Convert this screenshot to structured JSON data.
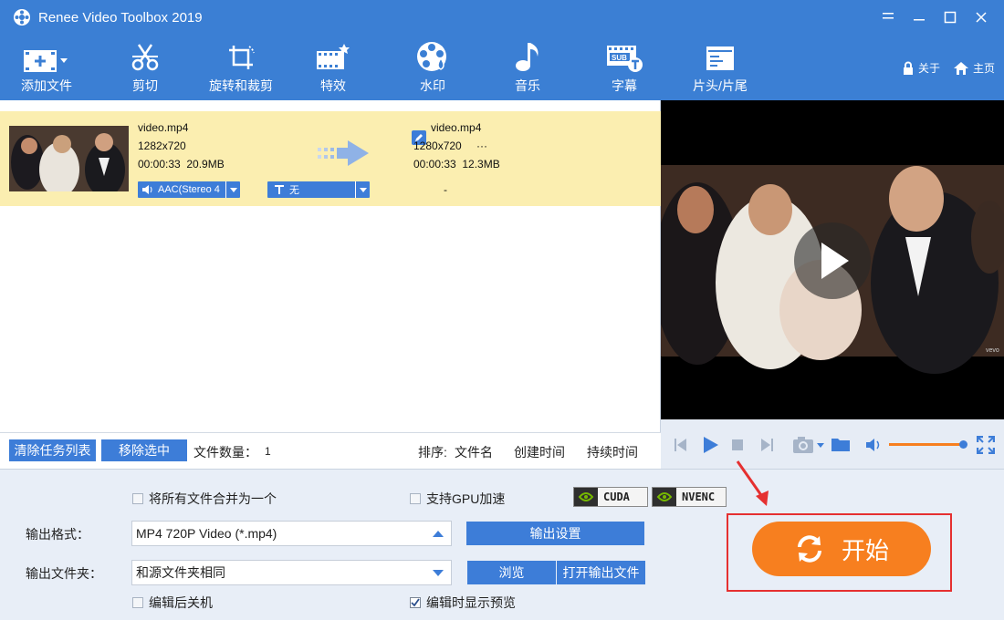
{
  "window": {
    "title": "Renee Video Toolbox 2019"
  },
  "toolbar": {
    "items": [
      {
        "label": "添加文件",
        "icon": "add-file-icon"
      },
      {
        "label": "剪切",
        "icon": "scissors-icon"
      },
      {
        "label": "旋转和裁剪",
        "icon": "rotate-crop-icon"
      },
      {
        "label": "特效",
        "icon": "effects-icon"
      },
      {
        "label": "水印",
        "icon": "watermark-icon"
      },
      {
        "label": "音乐",
        "icon": "music-note-icon"
      },
      {
        "label": "字幕",
        "icon": "subtitle-icon"
      },
      {
        "label": "片头/片尾",
        "icon": "intro-outro-icon"
      }
    ],
    "about_label": "关于",
    "home_label": "主页"
  },
  "file": {
    "source": {
      "name": "video.mp4",
      "resolution": "1282x720",
      "duration_size": "00:00:33  20.9MB"
    },
    "output": {
      "name": "video.mp4",
      "resolution": "1280x720",
      "more": "···",
      "duration_size": "00:00:33  12.3MB"
    },
    "audio_track": "AAC(Stereo 4",
    "subtitle_track": "无",
    "output_extra": "-"
  },
  "list_footer": {
    "clear_button": "清除任务列表",
    "remove_button": "移除选中",
    "file_count_label": "文件数量：",
    "file_count": "1",
    "sort_label": "排序:",
    "sort_filename": "文件名",
    "sort_created": "创建时间",
    "sort_duration": "持续时间"
  },
  "settings": {
    "merge_label": "将所有文件合并为一个",
    "merge_checked": false,
    "gpu_label": "支持GPU加速",
    "gpu_checked": false,
    "cuda_label": "CUDA",
    "nvenc_label": "NVENC",
    "format_label": "输出格式：",
    "format_value": "MP4 720P Video (*.mp4)",
    "output_settings_button": "输出设置",
    "folder_label": "输出文件夹：",
    "folder_value": "和源文件夹相同",
    "browse_button": "浏览",
    "open_folder_button": "打开输出文件",
    "shutdown_label": "编辑后关机",
    "shutdown_checked": false,
    "preview_label": "编辑时显示预览",
    "preview_checked": true,
    "start_button": "开始"
  },
  "preview": {
    "watermark": "vevo"
  },
  "colors": {
    "brand_blue": "#3b7fd4",
    "highlight_row": "#fbeeb0",
    "start_orange": "#f77f1f",
    "annotation_red": "#e53030"
  }
}
